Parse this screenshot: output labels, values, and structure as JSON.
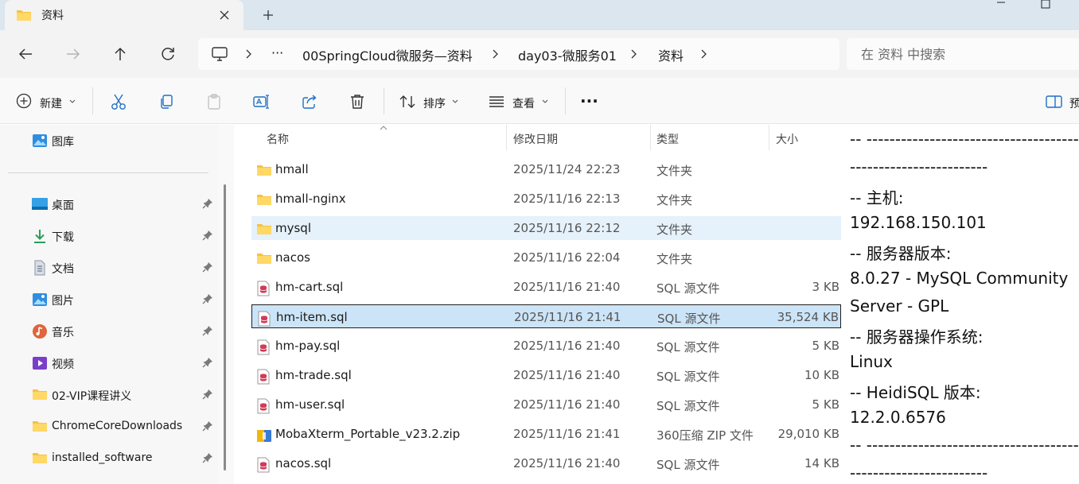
{
  "tab": {
    "title": "资料"
  },
  "breadcrumb": {
    "overflow": "···",
    "items": [
      "00SpringCloud微服务—资料",
      "day03-微服务01",
      "资料"
    ]
  },
  "search": {
    "placeholder": "在 资料 中搜索"
  },
  "commands": {
    "new_label": "新建",
    "sort_label": "排序",
    "view_label": "查看",
    "more_label": "···",
    "preview_label": "预"
  },
  "sidebar": {
    "top": {
      "label": "图库"
    },
    "items": [
      {
        "label": "桌面",
        "icon": "desktop-icon"
      },
      {
        "label": "下载",
        "icon": "download-icon"
      },
      {
        "label": "文档",
        "icon": "document-icon"
      },
      {
        "label": "图片",
        "icon": "pictures-icon"
      },
      {
        "label": "音乐",
        "icon": "music-icon"
      },
      {
        "label": "视频",
        "icon": "video-icon"
      },
      {
        "label": "02-VIP课程讲义",
        "icon": "folder-icon"
      },
      {
        "label": "ChromeCoreDownloads",
        "icon": "folder-icon"
      },
      {
        "label": "installed_software",
        "icon": "folder-icon"
      }
    ]
  },
  "columns": {
    "name": "名称",
    "date": "修改日期",
    "type": "类型",
    "size": "大小"
  },
  "files": [
    {
      "name": "hmall",
      "date": "2025/11/24 22:23",
      "type": "文件夹",
      "size": "",
      "kind": "folder"
    },
    {
      "name": "hmall-nginx",
      "date": "2025/11/16 22:13",
      "type": "文件夹",
      "size": "",
      "kind": "folder"
    },
    {
      "name": "mysql",
      "date": "2025/11/16 22:12",
      "type": "文件夹",
      "size": "",
      "kind": "folder"
    },
    {
      "name": "nacos",
      "date": "2025/11/16 22:04",
      "type": "文件夹",
      "size": "",
      "kind": "folder"
    },
    {
      "name": "hm-cart.sql",
      "date": "2025/11/16 21:40",
      "type": "SQL 源文件",
      "size": "3 KB",
      "kind": "sql"
    },
    {
      "name": "hm-item.sql",
      "date": "2025/11/16 21:41",
      "type": "SQL 源文件",
      "size": "35,524 KB",
      "kind": "sql"
    },
    {
      "name": "hm-pay.sql",
      "date": "2025/11/16 21:40",
      "type": "SQL 源文件",
      "size": "5 KB",
      "kind": "sql"
    },
    {
      "name": "hm-trade.sql",
      "date": "2025/11/16 21:40",
      "type": "SQL 源文件",
      "size": "10 KB",
      "kind": "sql"
    },
    {
      "name": "hm-user.sql",
      "date": "2025/11/16 21:40",
      "type": "SQL 源文件",
      "size": "5 KB",
      "kind": "sql"
    },
    {
      "name": "MobaXterm_Portable_v23.2.zip",
      "date": "2025/11/16 21:41",
      "type": "360压缩 ZIP 文件",
      "size": "29,010 KB",
      "kind": "zip"
    },
    {
      "name": "nacos.sql",
      "date": "2025/11/16 21:40",
      "type": "SQL 源文件",
      "size": "14 KB",
      "kind": "sql"
    }
  ],
  "preview": {
    "lines": [
      "-- --------------------------------------------",
      "------------------------",
      "-- 主机:",
      "192.168.150.101",
      "-- 服务器版本:",
      "8.0.27 - MySQL Community",
      "Server - GPL",
      "-- 服务器操作系统:",
      "Linux",
      "-- HeidiSQL 版本:",
      "12.2.0.6576",
      "-- --------------------------------------------",
      "------------------------"
    ]
  },
  "colors": {
    "selected_row": "#cce4f7",
    "hover_row": "#e5f1fb",
    "folder": "#f5c242",
    "titlebar": "#dbe6ef"
  }
}
